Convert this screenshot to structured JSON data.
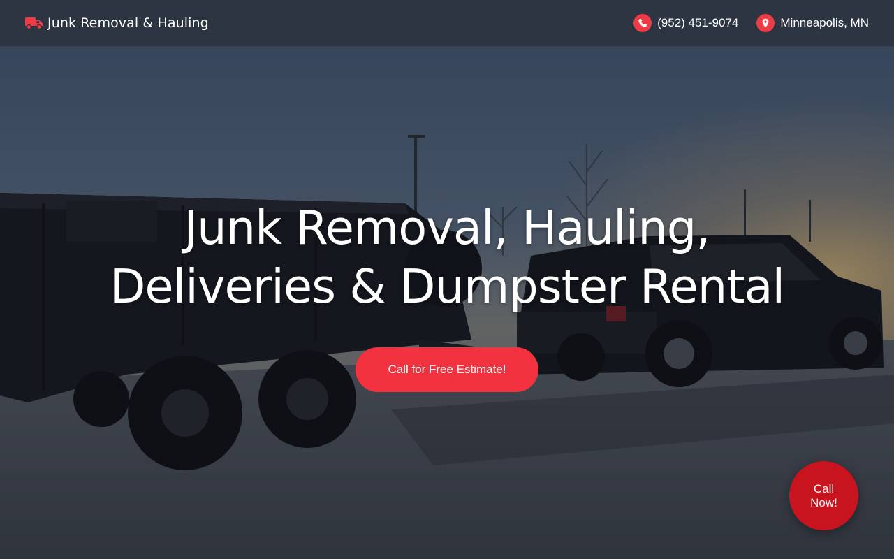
{
  "brand": {
    "name": "Junk Removal & Hauling",
    "icon": "truck-icon"
  },
  "contacts": {
    "phone": {
      "label": "(952) 451-9074",
      "icon": "phone-icon"
    },
    "location": {
      "label": "Minneapolis, MN",
      "icon": "map-pin-icon"
    }
  },
  "hero": {
    "title_line1": "Junk Removal, Hauling,",
    "title_line2": "Deliveries & Dumpster Rental",
    "cta_label": "Call for Free Estimate!"
  },
  "floating_call": {
    "label": "Call Now!"
  },
  "colors": {
    "accent": "#ef3b45",
    "header_bg": "#2d3442",
    "call_now_bg": "#c8141f"
  }
}
